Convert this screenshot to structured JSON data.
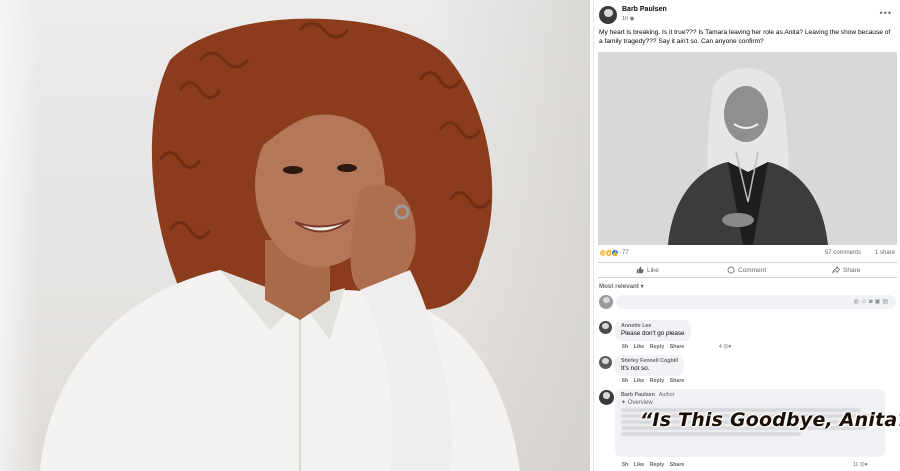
{
  "post": {
    "author": "Barb Paulsen",
    "time": "1h",
    "privacy_icon": "globe-icon",
    "more": "•••",
    "text": "My heart is breaking.  Is it true???  Is Tamara leaving her role as Anita?  Leaving the show because of a family tragedy???  Say it ain't so.  Can anyone confirm?",
    "reaction_count": "77",
    "comments_count": "57 comments",
    "shares_count": "1 share"
  },
  "actions": {
    "like": "Like",
    "comment": "Comment",
    "share": "Share"
  },
  "sort_label": "Most relevant",
  "comments": [
    {
      "name": "Annette Lee",
      "text": "Please don't go please",
      "actions": "6h  Like  Reply  Share",
      "reactions": "4"
    },
    {
      "name": "Shirley Fennell Cogbill",
      "text": "It's not so.",
      "actions": "6h  Like  Reply  Share",
      "reactions": ""
    },
    {
      "name": "Barb Paulsen",
      "author_tag": "Author",
      "text": "Overview",
      "actions": "5h  Like  Reply  Share",
      "reactions": "11"
    }
  ],
  "caption": "“Is This Goodbye, Anita?”",
  "colors": {
    "link_blue": "#1877f2",
    "muted": "#65676b",
    "bubble": "#f0f2f5"
  }
}
